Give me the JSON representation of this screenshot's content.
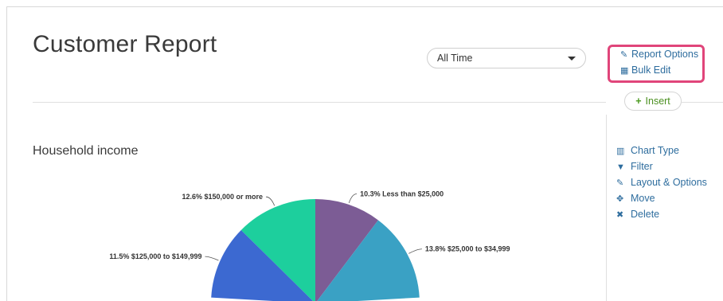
{
  "header": {
    "title": "Customer Report"
  },
  "date_filter": {
    "selected": "All Time"
  },
  "report_menu": {
    "report_options_label": "Report Options",
    "bulk_edit_label": "Bulk Edit",
    "highlight_color": "#e0457a"
  },
  "insert_button": {
    "label": "Insert"
  },
  "question": {
    "title": "Household income"
  },
  "chart_actions": [
    {
      "label": "Chart Type",
      "icon": "bar-chart-icon"
    },
    {
      "label": "Filter",
      "icon": "filter-icon"
    },
    {
      "label": "Layout & Options",
      "icon": "pencil-icon"
    },
    {
      "label": "Move",
      "icon": "move-icon"
    },
    {
      "label": "Delete",
      "icon": "close-icon"
    }
  ],
  "chart_data": {
    "type": "pie",
    "title": "Household income",
    "slices": [
      {
        "label": "10.3% Less than $25,000",
        "category": "Less than $25,000",
        "percent": 10.3,
        "color": "#7c5c95"
      },
      {
        "label": "13.8% $25,000 to $34,999",
        "category": "$25,000 to $34,999",
        "percent": 13.8,
        "color": "#3aa1c4"
      },
      {
        "label": "11.5% $125,000 to $149,999",
        "category": "$125,000 to $149,999",
        "percent": 11.5,
        "color": "#3c69d1"
      },
      {
        "label": "12.6% $150,000 or more",
        "category": "$150,000 or more",
        "percent": 12.6,
        "color": "#1dcf9d"
      }
    ]
  }
}
